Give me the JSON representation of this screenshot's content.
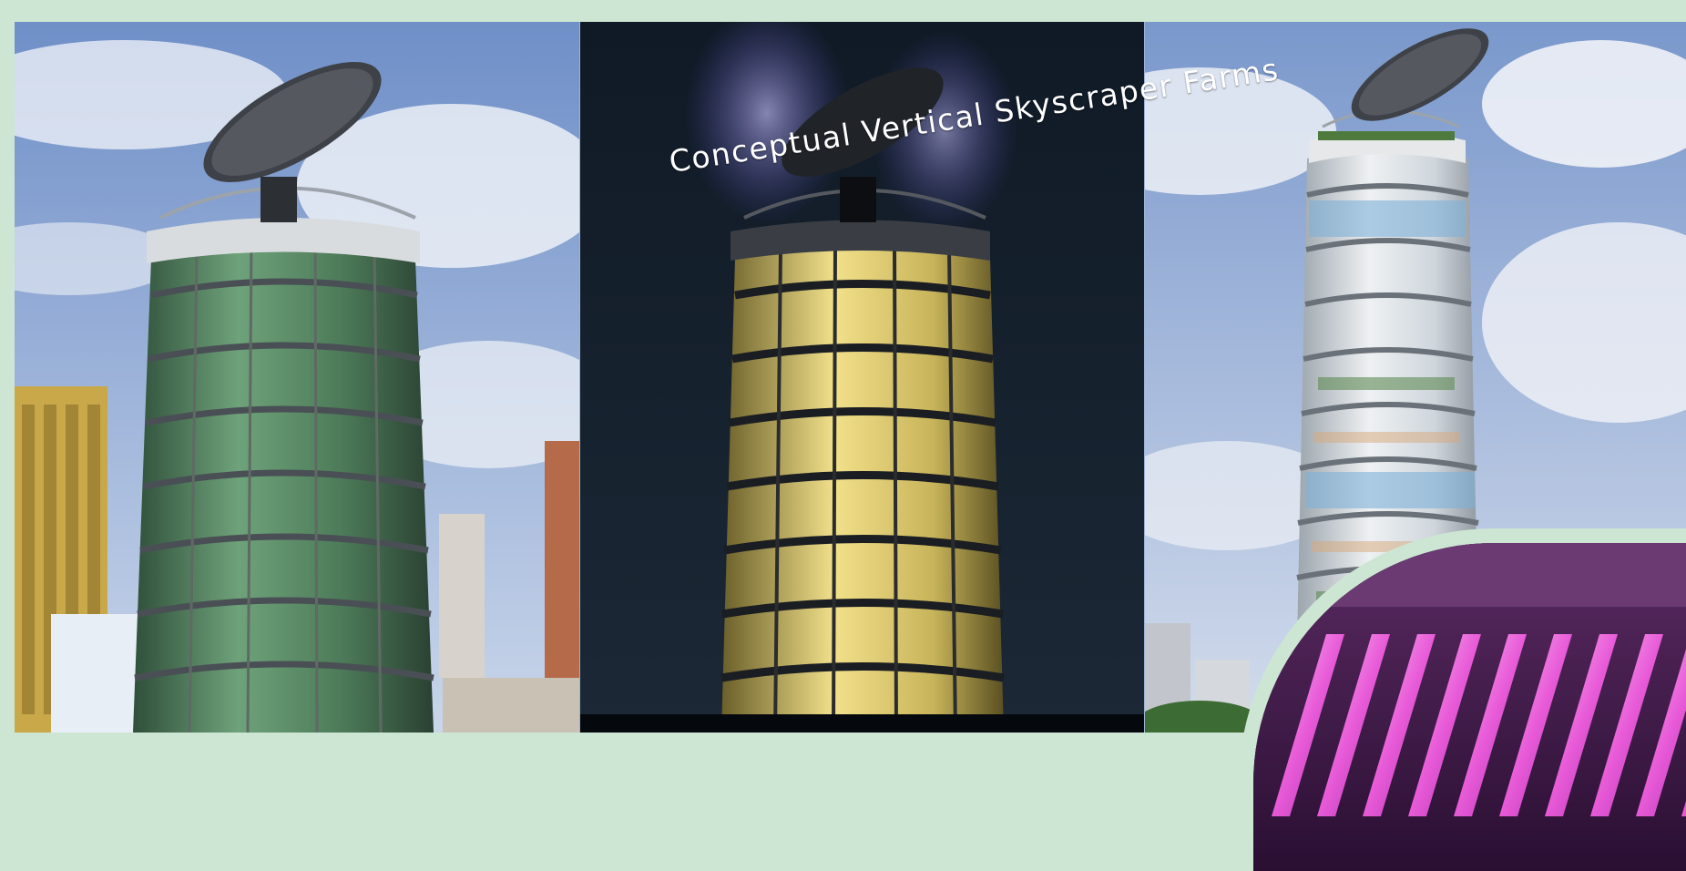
{
  "title": "Conceptual Vertical Skyscraper Farms",
  "panels": [
    {
      "scene": "day-tower-green-glass"
    },
    {
      "scene": "night-tower-lit"
    },
    {
      "scene": "day-tower-white-bands"
    }
  ],
  "inset": {
    "scene": "led-grow-lights"
  },
  "colors": {
    "border": "#cde6d3",
    "sky": "#8eaad4",
    "night": "#0b1622",
    "glass_green": "#3f6f4c",
    "glass_lit": "#e8d77a",
    "led_pink": "#e85ad8"
  }
}
